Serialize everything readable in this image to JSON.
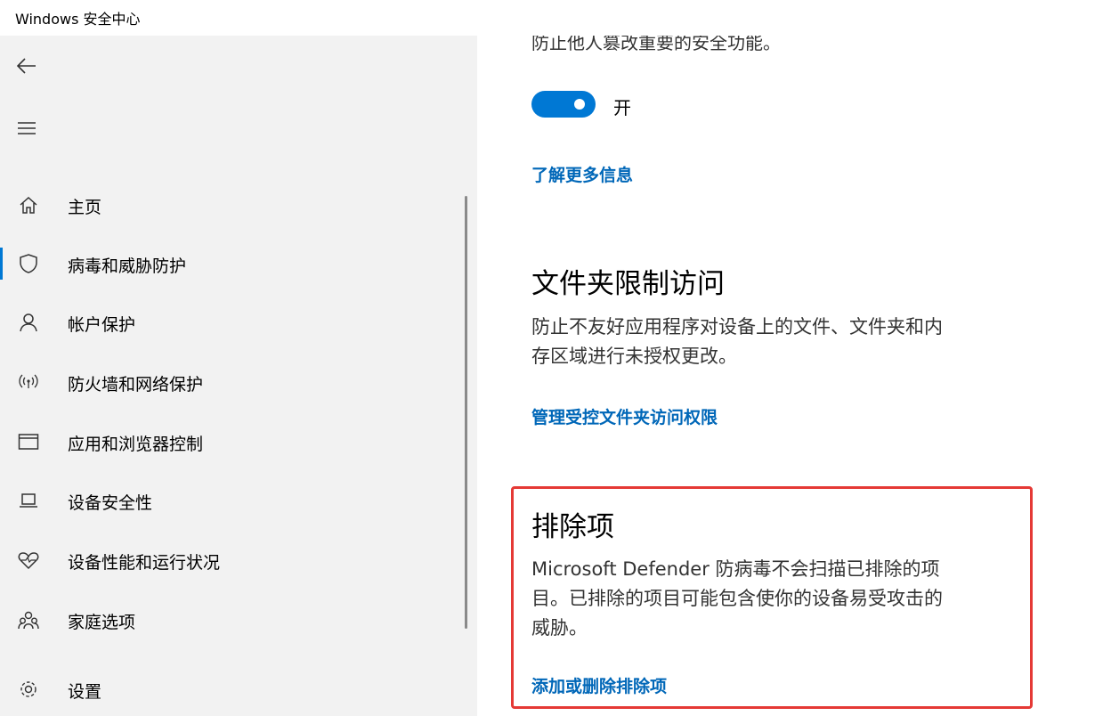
{
  "window": {
    "title": "Windows 安全中心"
  },
  "sidebar": {
    "items": [
      {
        "label": "主页",
        "icon": "home-icon"
      },
      {
        "label": "病毒和威胁防护",
        "icon": "shield-icon"
      },
      {
        "label": "帐户保护",
        "icon": "person-icon"
      },
      {
        "label": "防火墙和网络保护",
        "icon": "wifi-signal-icon"
      },
      {
        "label": "应用和浏览器控制",
        "icon": "app-window-icon"
      },
      {
        "label": "设备安全性",
        "icon": "laptop-icon"
      },
      {
        "label": "设备性能和运行状况",
        "icon": "heart-icon"
      },
      {
        "label": "家庭选项",
        "icon": "family-icon"
      },
      {
        "label": "设置",
        "icon": "gear-icon"
      }
    ],
    "active_index": 1
  },
  "main": {
    "cut_text": "防止他人篡改重要的安全功能。",
    "toggle": {
      "state_label": "开",
      "on": true
    },
    "learn_more_link": "了解更多信息",
    "cfa": {
      "heading": "文件夹限制访问",
      "desc_line1": "防止不友好应用程序对设备上的文件、文件夹和内",
      "desc_line2": "存区域进行未授权更改。",
      "link": "管理受控文件夹访问权限"
    },
    "exclusions": {
      "heading": "排除项",
      "desc_line1": "Microsoft Defender 防病毒不会扫描已排除的项",
      "desc_line2": "目。已排除的项目可能包含使你的设备易受攻击的",
      "desc_line3": "威胁。",
      "link": "添加或删除排除项"
    }
  },
  "colors": {
    "accent": "#0078d4",
    "link": "#0067b8",
    "highlight": "#e53935"
  }
}
